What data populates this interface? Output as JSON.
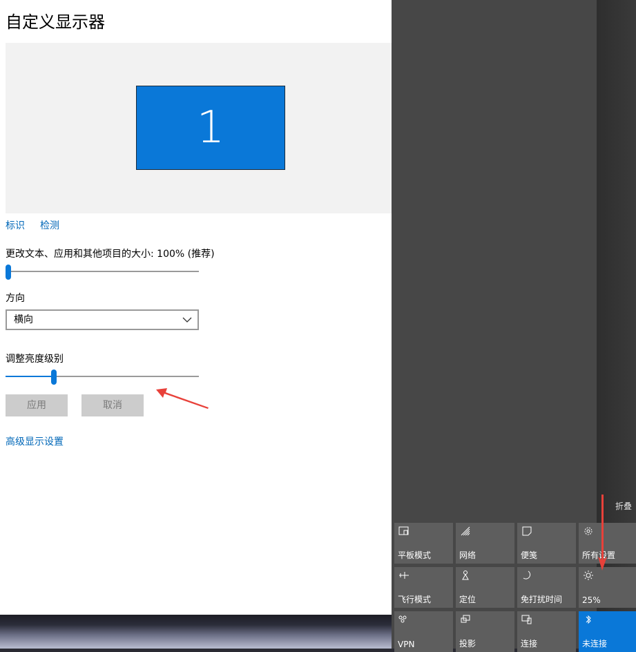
{
  "settings": {
    "title": "自定义显示器",
    "monitor_number": "1",
    "identify_link": "标识",
    "detect_link": "检测",
    "scale_label": "更改文本、应用和其他项目的大小: 100% (推荐)",
    "scale_value_percent": 0,
    "orientation_label": "方向",
    "orientation_value": "横向",
    "brightness_label": "调整亮度级别",
    "brightness_value_percent": 25,
    "apply_button": "应用",
    "cancel_button": "取消",
    "advanced_link": "高级显示设置"
  },
  "action_center": {
    "collapse_label": "折叠",
    "tiles": [
      {
        "label": "平板模式",
        "icon": "tablet-mode-icon",
        "active": false
      },
      {
        "label": "网络",
        "icon": "network-icon",
        "active": false
      },
      {
        "label": "便笺",
        "icon": "note-icon",
        "active": false
      },
      {
        "label": "所有设置",
        "icon": "gear-icon",
        "active": false
      },
      {
        "label": "飞行模式",
        "icon": "airplane-icon",
        "active": false
      },
      {
        "label": "定位",
        "icon": "location-icon",
        "active": false
      },
      {
        "label": "免打扰时间",
        "icon": "moon-icon",
        "active": false
      },
      {
        "label": "25%",
        "icon": "brightness-icon",
        "active": false
      },
      {
        "label": "VPN",
        "icon": "vpn-icon",
        "active": false
      },
      {
        "label": "投影",
        "icon": "project-icon",
        "active": false
      },
      {
        "label": "连接",
        "icon": "connect-icon",
        "active": false
      },
      {
        "label": "未连接",
        "icon": "bluetooth-icon",
        "active": true
      }
    ]
  },
  "colors": {
    "accent": "#0a78d8",
    "link": "#0067b8",
    "annotation_arrow": "#e8413a"
  }
}
